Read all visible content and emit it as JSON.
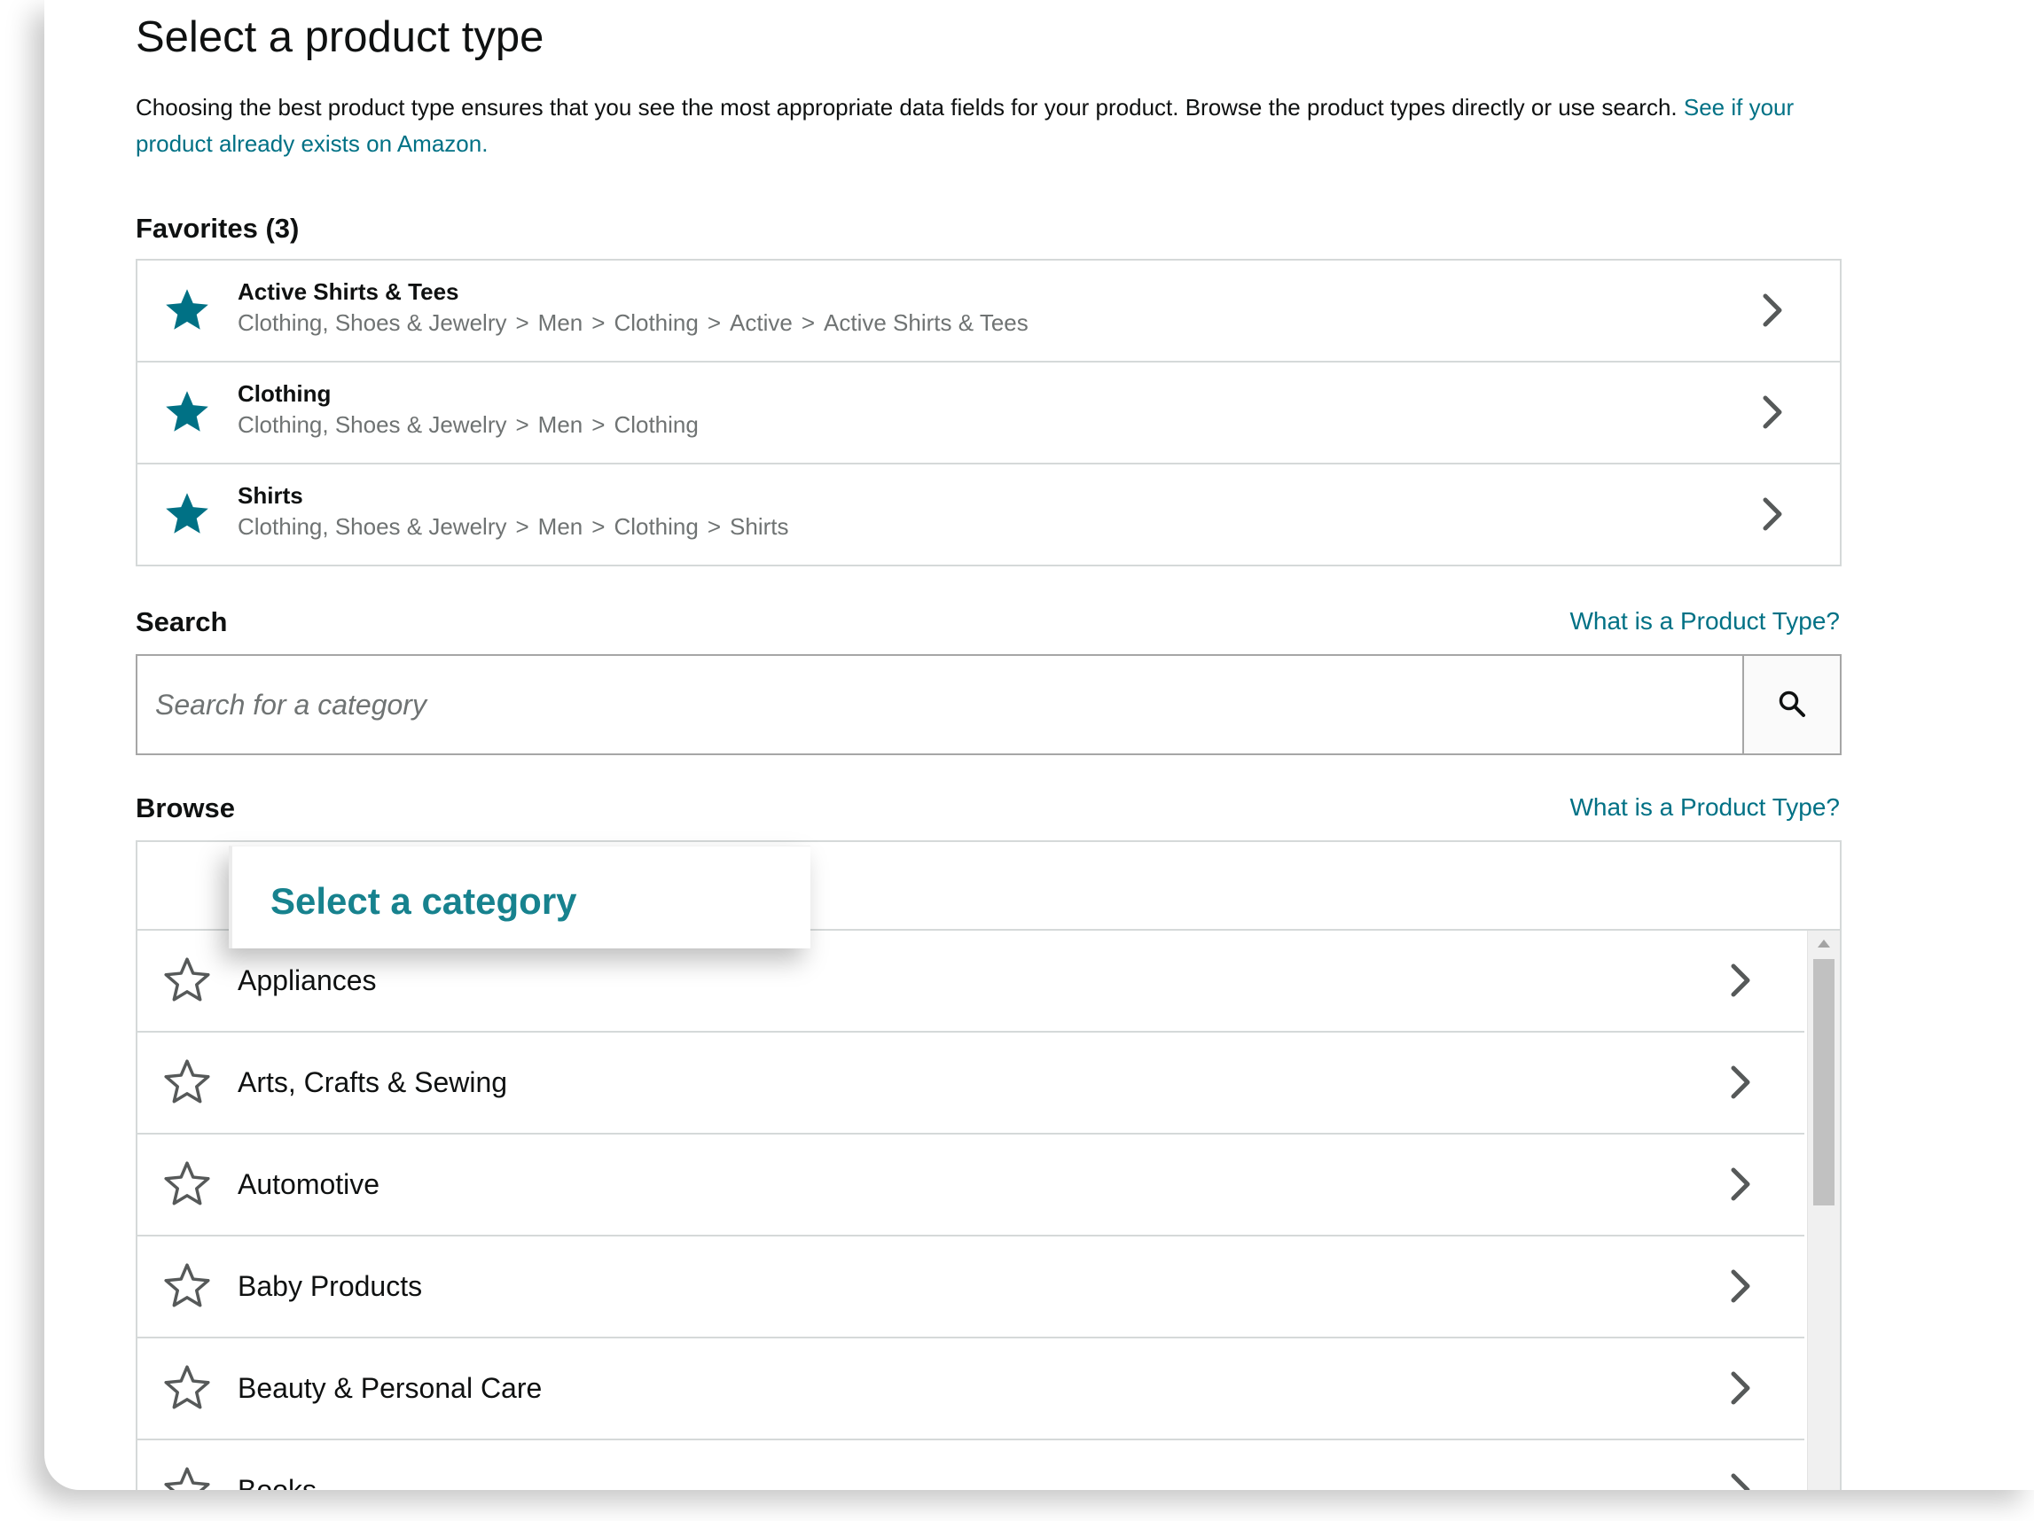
{
  "page": {
    "title": "Select a product type",
    "intro_text": "Choosing the best product type ensures that you see the most appropriate data fields for your product. Browse the product types directly or use search.",
    "intro_link": "See if your product already exists on Amazon."
  },
  "favorites": {
    "heading": "Favorites (3)",
    "items": [
      {
        "title": "Active Shirts & Tees",
        "path": [
          "Clothing, Shoes & Jewelry",
          "Men",
          "Clothing",
          "Active",
          "Active Shirts & Tees"
        ]
      },
      {
        "title": "Clothing",
        "path": [
          "Clothing, Shoes & Jewelry",
          "Men",
          "Clothing"
        ]
      },
      {
        "title": "Shirts",
        "path": [
          "Clothing, Shoes & Jewelry",
          "Men",
          "Clothing",
          "Shirts"
        ]
      }
    ]
  },
  "search": {
    "heading": "Search",
    "help_link": "What is a Product Type?",
    "placeholder": "Search for a category"
  },
  "browse": {
    "heading": "Browse",
    "help_link": "What is a Product Type?",
    "callout": "Select a category",
    "categories": [
      "Appliances",
      "Arts, Crafts & Sewing",
      "Automotive",
      "Baby Products",
      "Beauty & Personal Care",
      "Books"
    ]
  },
  "colors": {
    "accent": "#007185",
    "star_filled": "#007185",
    "callout_text": "#17828e",
    "border": "#d5d9d9",
    "path_text": "#6f7373"
  },
  "icons": {
    "favorite": "star-filled-icon",
    "category": "star-outline-icon",
    "row_action": "chevron-right-icon",
    "search": "search-icon"
  },
  "separator": ">"
}
